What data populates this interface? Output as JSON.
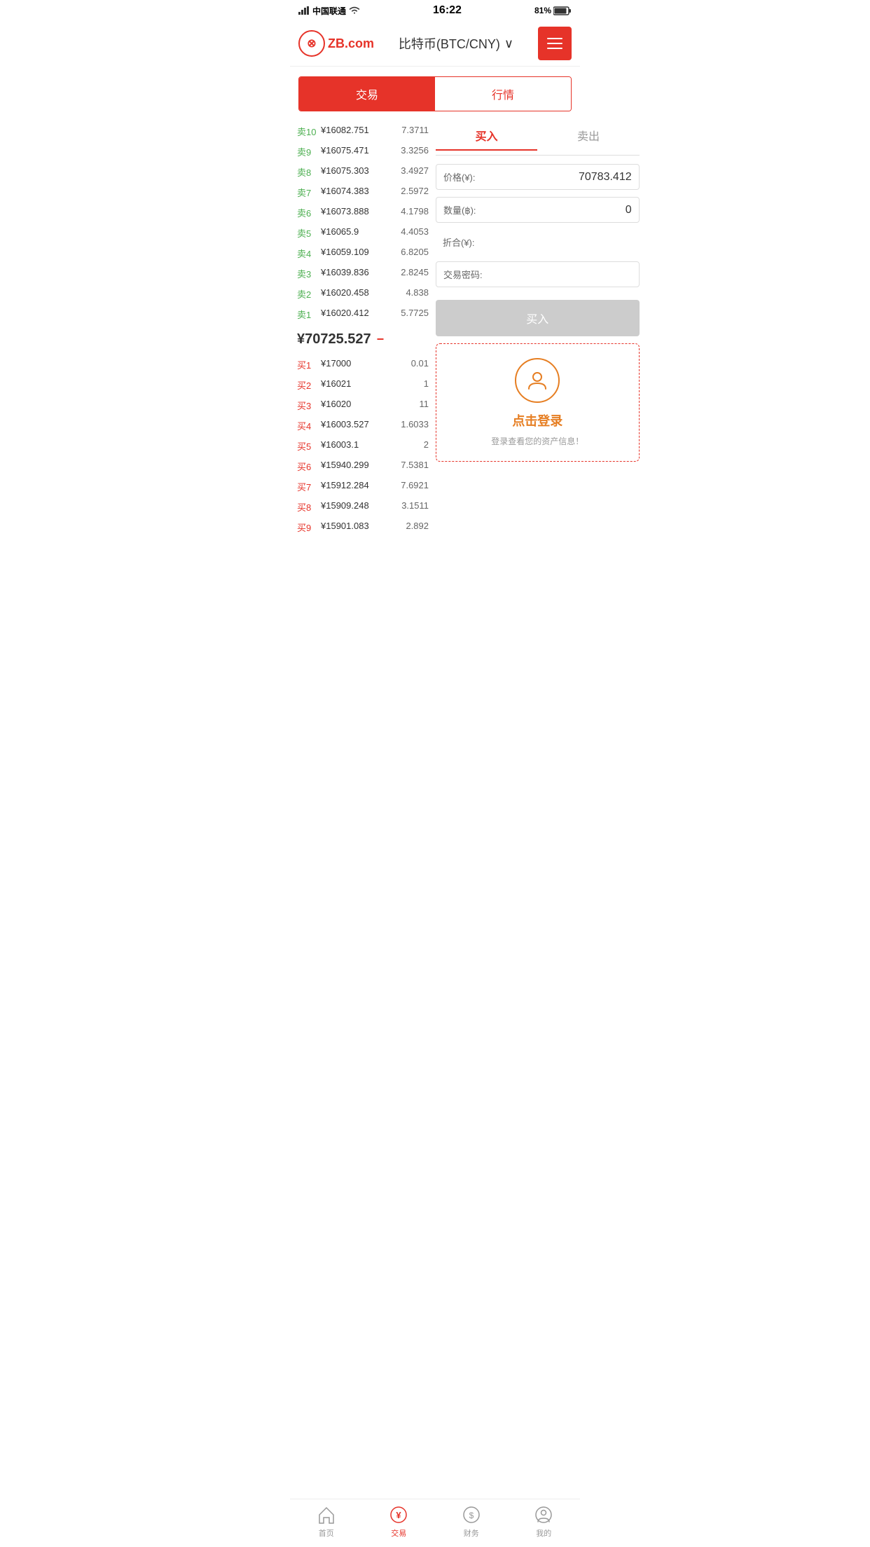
{
  "statusBar": {
    "carrier": "中国联通",
    "time": "16:22",
    "battery": "81%"
  },
  "header": {
    "logoText": "ZB.com",
    "title": "比特币(BTC/CNY)",
    "menuIcon": "menu-icon"
  },
  "tabs": {
    "trade": "交易",
    "market": "行情"
  },
  "tradeTabs": {
    "buy": "买入",
    "sell": "卖出"
  },
  "sellOrders": [
    {
      "label": "卖10",
      "price": "¥16082.751",
      "qty": "7.3711"
    },
    {
      "label": "卖9",
      "price": "¥16075.471",
      "qty": "3.3256"
    },
    {
      "label": "卖8",
      "price": "¥16075.303",
      "qty": "3.4927"
    },
    {
      "label": "卖7",
      "price": "¥16074.383",
      "qty": "2.5972"
    },
    {
      "label": "卖6",
      "price": "¥16073.888",
      "qty": "4.1798"
    },
    {
      "label": "卖5",
      "price": "¥16065.9",
      "qty": "4.4053"
    },
    {
      "label": "卖4",
      "price": "¥16059.109",
      "qty": "6.8205"
    },
    {
      "label": "卖3",
      "price": "¥16039.836",
      "qty": "2.8245"
    },
    {
      "label": "卖2",
      "price": "¥16020.458",
      "qty": "4.838"
    },
    {
      "label": "卖1",
      "price": "¥16020.412",
      "qty": "5.7725"
    }
  ],
  "currentPrice": "¥70725.527",
  "priceDirection": "−",
  "buyOrders": [
    {
      "label": "买1",
      "price": "¥17000",
      "qty": "0.01"
    },
    {
      "label": "买2",
      "price": "¥16021",
      "qty": "1"
    },
    {
      "label": "买3",
      "price": "¥16020",
      "qty": "11"
    },
    {
      "label": "买4",
      "price": "¥16003.527",
      "qty": "1.6033"
    },
    {
      "label": "买5",
      "price": "¥16003.1",
      "qty": "2"
    },
    {
      "label": "买6",
      "price": "¥15940.299",
      "qty": "7.5381"
    },
    {
      "label": "买7",
      "price": "¥15912.284",
      "qty": "7.6921"
    },
    {
      "label": "买8",
      "price": "¥15909.248",
      "qty": "3.1511"
    },
    {
      "label": "买9",
      "price": "¥15901.083",
      "qty": "2.892"
    }
  ],
  "tradeForm": {
    "priceLabel": "价格(¥):",
    "priceValue": "70783.412",
    "qtyLabel": "数量(฿):",
    "qtyValue": "0",
    "totalLabel": "折合(¥):",
    "totalValue": "",
    "passwordLabel": "交易密码:",
    "passwordValue": "",
    "buyButtonLabel": "买入"
  },
  "loginCard": {
    "loginLabel": "点击登录",
    "hintText": "登录查看您的资产信息！"
  },
  "bottomNav": [
    {
      "label": "首页",
      "icon": "home-icon",
      "active": false
    },
    {
      "label": "交易",
      "icon": "trade-icon",
      "active": true
    },
    {
      "label": "财务",
      "icon": "finance-icon",
      "active": false
    },
    {
      "label": "我的",
      "icon": "profile-icon",
      "active": false
    }
  ]
}
